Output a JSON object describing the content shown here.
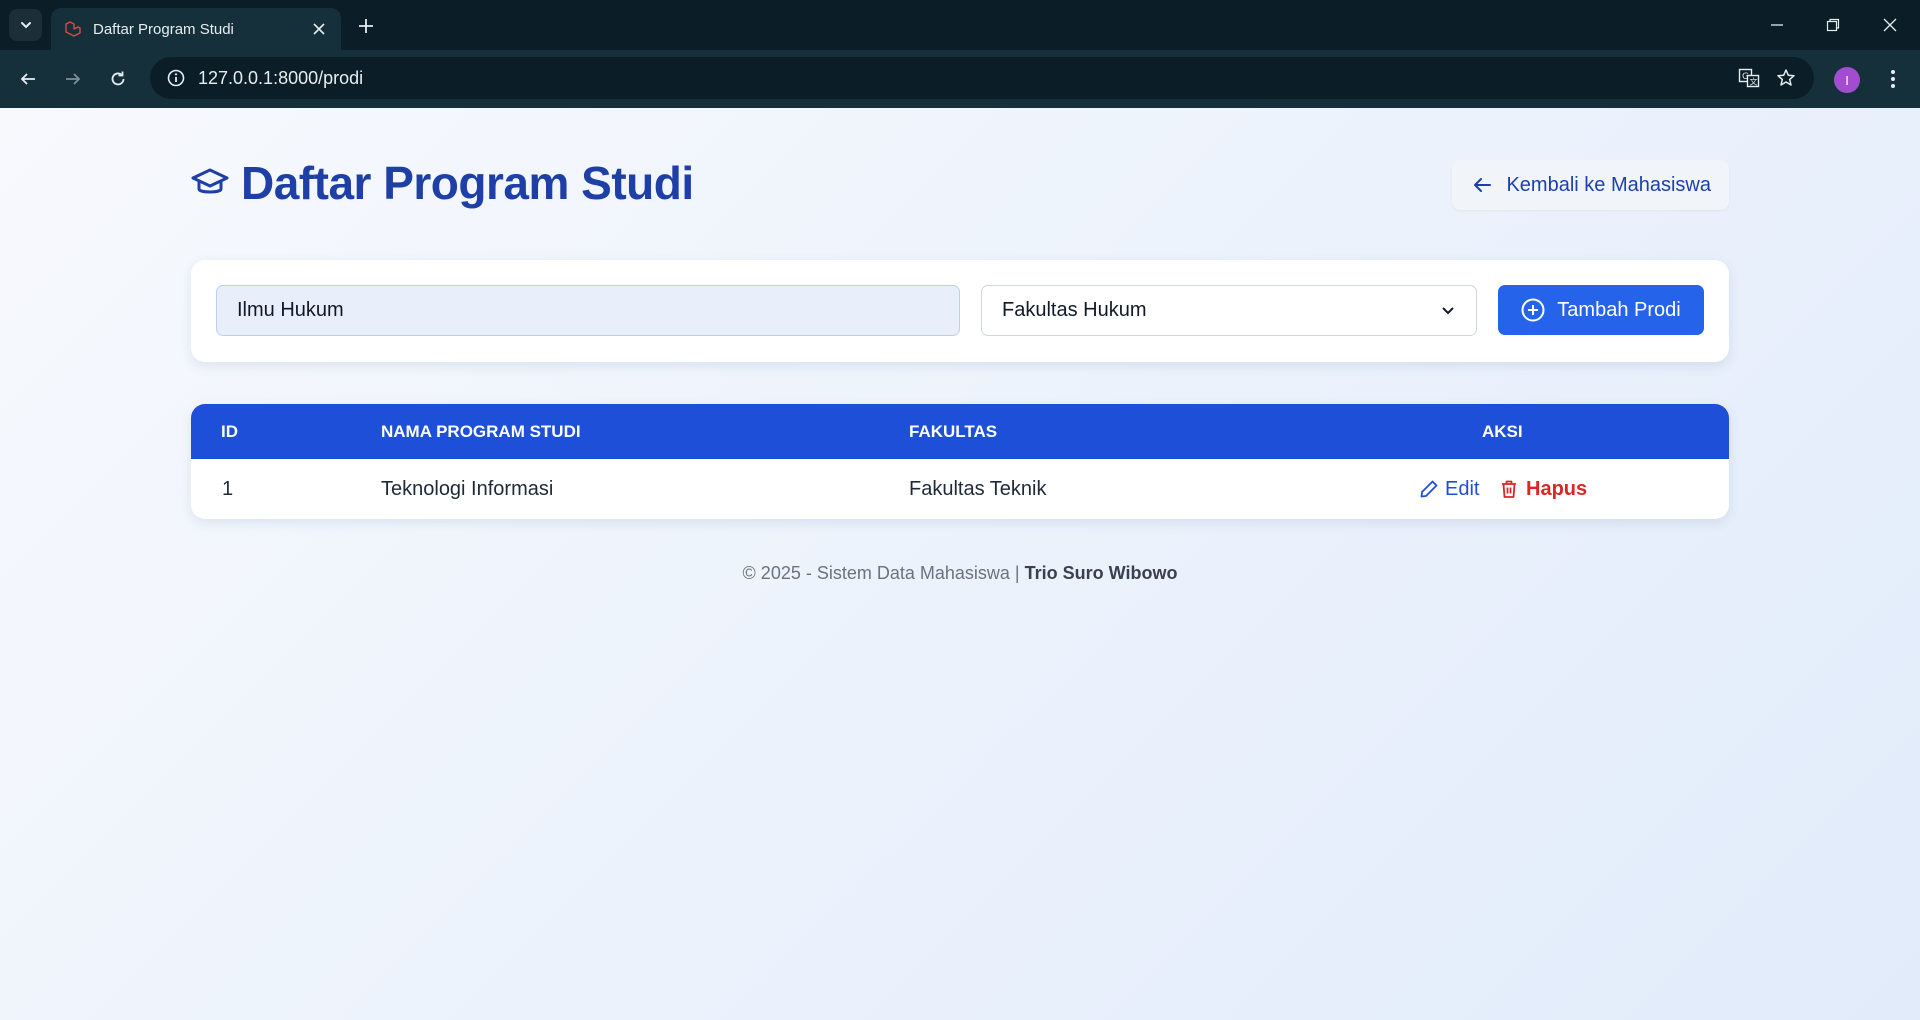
{
  "browser": {
    "tab_title": "Daftar Program Studi",
    "url": "127.0.0.1:8000/prodi",
    "profile_initial": "I"
  },
  "header": {
    "title": "Daftar Program Studi",
    "back_label": "Kembali ke Mahasiswa"
  },
  "filters": {
    "search_value": "Ilmu Hukum",
    "fakultas_selected": "Fakultas Hukum",
    "add_label": "Tambah Prodi"
  },
  "table": {
    "columns": [
      "ID",
      "NAMA PROGRAM STUDI",
      "FAKULTAS",
      "AKSI"
    ],
    "rows": [
      {
        "id": "1",
        "nama": "Teknologi Informasi",
        "fakultas": "Fakultas Teknik",
        "edit_label": "Edit",
        "delete_label": "Hapus"
      }
    ]
  },
  "footer": {
    "text": "© 2025 - Sistem Data Mahasiswa |",
    "author": "Trio Suro Wibowo"
  },
  "colors": {
    "primary": "#1d4fd8",
    "title": "#1e3fa6",
    "danger": "#dc2626"
  }
}
